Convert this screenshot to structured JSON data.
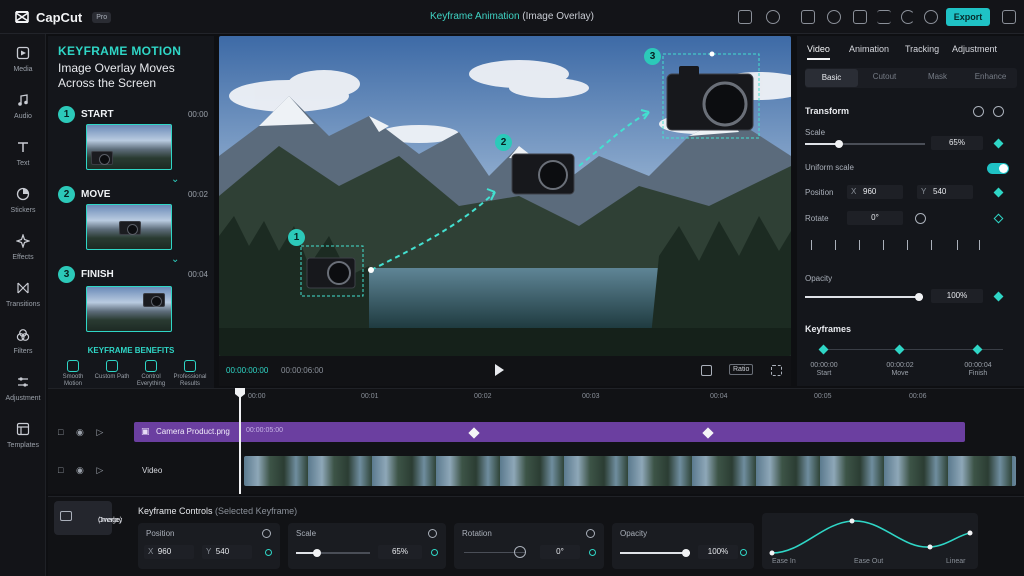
{
  "app": {
    "name": "CapCut",
    "badge": "Pro",
    "title_main": "Keyframe Animation",
    "title_sub": "(Image Overlay)",
    "export_label": "Export"
  },
  "sidebar": {
    "items": [
      {
        "label": "Media",
        "icon": "media-icon"
      },
      {
        "label": "Audio",
        "icon": "music-icon"
      },
      {
        "label": "Text",
        "icon": "text-icon"
      },
      {
        "label": "Stickers",
        "icon": "sticker-icon"
      },
      {
        "label": "Effects",
        "icon": "effects-icon"
      },
      {
        "label": "Transitions",
        "icon": "transition-icon"
      },
      {
        "label": "Filters",
        "icon": "filters-icon"
      },
      {
        "label": "Adjustment",
        "icon": "adjust-icon"
      },
      {
        "label": "Templates",
        "icon": "templates-icon"
      }
    ]
  },
  "tutorial": {
    "heading": "KEYFRAME MOTION",
    "subheading": "Image Overlay Moves Across the Screen",
    "steps": [
      {
        "num": "1",
        "label": "START",
        "time": "00:00"
      },
      {
        "num": "2",
        "label": "MOVE",
        "time": "00:02"
      },
      {
        "num": "3",
        "label": "FINISH",
        "time": "00:04"
      }
    ],
    "benefits_heading": "KEYFRAME BENEFITS",
    "benefits": [
      "Smooth Motion",
      "Custom Path",
      "Control Everything",
      "Professional Results"
    ]
  },
  "preview": {
    "markers": [
      "1",
      "2",
      "3"
    ],
    "current_time": "00:00:00:00",
    "total_time": "00:00:06:00",
    "ratio_label": "Ratio"
  },
  "properties": {
    "tabs": [
      "Video",
      "Animation",
      "Tracking",
      "Adjustment"
    ],
    "subtabs": [
      "Basic",
      "Cutout",
      "Mask",
      "Enhance"
    ],
    "transform_heading": "Transform",
    "scale_label": "Scale",
    "scale_value": "65%",
    "scale_fraction": 0.28,
    "uniform_scale_label": "Uniform scale",
    "position_label": "Position",
    "pos_x_label": "X",
    "pos_x": "960",
    "pos_y_label": "Y",
    "pos_y": "540",
    "rotate_label": "Rotate",
    "rotate_value": "0°",
    "opacity_label": "Opacity",
    "opacity_value": "100%",
    "opacity_fraction": 1.0,
    "keyframes_heading": "Keyframes",
    "keyframes": [
      {
        "time": "00:00:00",
        "label": "Start"
      },
      {
        "time": "00:00:02",
        "label": "Move"
      },
      {
        "time": "00:00:04",
        "label": "Finish"
      }
    ]
  },
  "timeline": {
    "ticks": [
      "00:00",
      "00:01",
      "00:02",
      "00:03",
      "00:04",
      "00:05",
      "00:06"
    ],
    "overlay_clip_name": "Camera Product.png",
    "overlay_clip_duration": "00:00:05:00",
    "video_track_label": "Video"
  },
  "bottom": {
    "chip_label_1": "Overlay",
    "chip_label_2": "(Image)",
    "title": "Keyframe Controls",
    "title_sub": "(Selected Keyframe)",
    "position_label": "Position",
    "pos_x_label": "X",
    "pos_x": "960",
    "pos_y_label": "Y",
    "pos_y": "540",
    "scale_label": "Scale",
    "scale_value": "65%",
    "scale_fraction": 0.28,
    "rotation_label": "Rotation",
    "rotation_value": "0°",
    "opacity_label": "Opacity",
    "opacity_value": "100%",
    "opacity_fraction": 1.0,
    "ease_labels": [
      "Ease In",
      "Ease Out",
      "Linear"
    ]
  },
  "colors": {
    "accent": "#2fd6c6",
    "export": "#1fc2c5",
    "overlay_clip": "#6b3fa0"
  }
}
